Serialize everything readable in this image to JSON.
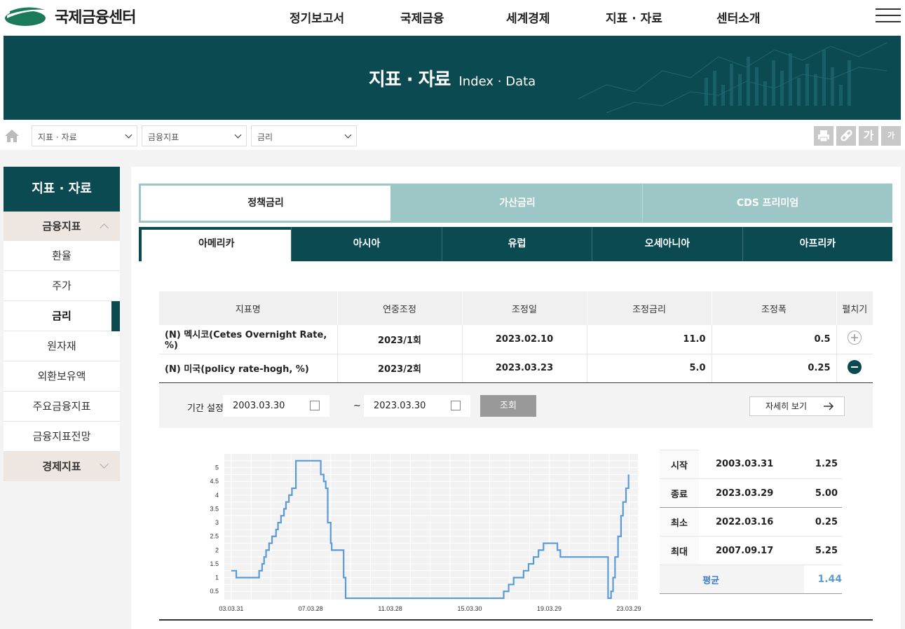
{
  "header": {
    "logo_text": "국제금융센터",
    "nav": [
      "정기보고서",
      "국제금융",
      "세계경제",
      "지표 · 자료",
      "센터소개"
    ]
  },
  "hero": {
    "title": "지표 · 자료",
    "subtitle": "Index · Data"
  },
  "breadcrumb": {
    "selects": [
      "지표 · 자료",
      "금융지표",
      "금리"
    ]
  },
  "tools": {
    "font_large": "가",
    "font_small": "가"
  },
  "sidebar": {
    "title": "지표 · 자료",
    "group1": "금융지표",
    "items": [
      "환율",
      "주가",
      "금리",
      "원자재",
      "외환보유액",
      "주요금융지표",
      "금융지표전망"
    ],
    "active_item": "금리",
    "group2": "경제지표"
  },
  "tabs1": [
    "정책금리",
    "가산금리",
    "CDS 프리미엄"
  ],
  "tabs2": [
    "아메리카",
    "아시아",
    "유럽",
    "오세아니아",
    "아프리카"
  ],
  "table": {
    "headers": [
      "지표명",
      "연중조정",
      "조정일",
      "조정금리",
      "조정폭",
      "펼치기"
    ],
    "rows": [
      {
        "name": "(N) 멕시코(Cetes Overnight Rate, %)",
        "annual": "2023/1회",
        "date": "2023.02.10",
        "rate": "11.0",
        "change": "0.5"
      },
      {
        "name": "(N) 미국(policy rate-hogh, %)",
        "annual": "2023/2회",
        "date": "2023.03.23",
        "rate": "5.0",
        "change": "0.25"
      }
    ]
  },
  "filter": {
    "label": "기간 설정",
    "start": "2003.03.30",
    "tilde": "~",
    "end": "2023.03.30",
    "search": "조회",
    "detail": "자세히 보기"
  },
  "stats": {
    "rows": [
      {
        "label": "시작",
        "date": "2003.03.31",
        "value": "1.25"
      },
      {
        "label": "종료",
        "date": "2023.03.29",
        "value": "5.00"
      },
      {
        "label": "최소",
        "date": "2022.03.16",
        "value": "0.25"
      },
      {
        "label": "최대",
        "date": "2007.09.17",
        "value": "5.25"
      }
    ],
    "avg_label": "평균",
    "avg_value": "1.44"
  },
  "colors": {
    "brand": "#0c4a52",
    "tab_light": "#9cc7c6",
    "line": "#5b9bd5"
  },
  "chart_data": {
    "type": "line",
    "x_ticks": [
      "03.03.31",
      "07.03.28",
      "11.03.28",
      "15.03.30",
      "19.03.29",
      "23.03.29"
    ],
    "y_ticks": [
      "0.5",
      "1",
      "1.5",
      "2",
      "2.5",
      "3",
      "3.5",
      "4",
      "4.5",
      "5"
    ],
    "ylim": [
      0.2,
      5.5
    ],
    "xlim": [
      2002.9,
      2023.7
    ],
    "grid": true,
    "x": [
      2003.25,
      2003.5,
      2004.5,
      2004.65,
      2004.8,
      2004.9,
      2005.0,
      2005.15,
      2005.3,
      2005.5,
      2005.6,
      2005.75,
      2005.9,
      2006.0,
      2006.15,
      2006.3,
      2006.5,
      2007.6,
      2007.75,
      2007.9,
      2008.0,
      2008.1,
      2008.25,
      2008.3,
      2008.75,
      2008.9,
      2009.0,
      2015.95,
      2016.95,
      2017.2,
      2017.45,
      2017.95,
      2018.2,
      2018.45,
      2018.7,
      2018.95,
      2019.55,
      2019.65,
      2019.8,
      2022.2,
      2022.35,
      2022.45,
      2022.55,
      2022.7,
      2022.85,
      2022.95,
      2023.1,
      2023.23
    ],
    "y": [
      1.25,
      1.0,
      1.0,
      1.25,
      1.5,
      1.75,
      2.0,
      2.25,
      2.5,
      2.75,
      3.0,
      3.25,
      3.5,
      3.75,
      4.0,
      4.25,
      5.25,
      5.25,
      4.75,
      4.5,
      4.25,
      3.0,
      2.25,
      2.0,
      2.0,
      1.0,
      0.25,
      0.25,
      0.5,
      0.75,
      1.0,
      1.25,
      1.5,
      1.75,
      2.0,
      2.25,
      2.25,
      2.0,
      1.75,
      0.25,
      0.5,
      1.0,
      1.75,
      2.5,
      3.25,
      3.75,
      4.25,
      4.75
    ]
  }
}
